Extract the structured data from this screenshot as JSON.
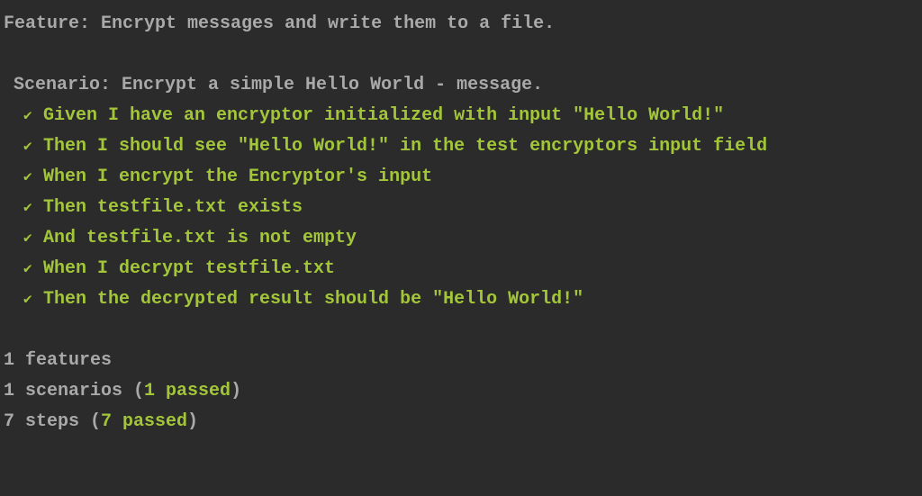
{
  "feature": {
    "label": "Feature: Encrypt messages and write them to a file."
  },
  "scenario": {
    "label": " Scenario: Encrypt a simple Hello World - message.",
    "steps": [
      {
        "check": "✔",
        "text": "Given I have an encryptor initialized with input \"Hello World!\""
      },
      {
        "check": "✔",
        "text": "Then I should see \"Hello World!\" in the test encryptors input field"
      },
      {
        "check": "✔",
        "text": "When I encrypt the Encryptor's input"
      },
      {
        "check": "✔",
        "text": "Then testfile.txt exists"
      },
      {
        "check": "✔",
        "text": "And testfile.txt is not empty"
      },
      {
        "check": "✔",
        "text": "When I decrypt testfile.txt"
      },
      {
        "check": "✔",
        "text": "Then the decrypted result should be \"Hello World!\""
      }
    ]
  },
  "summary": {
    "features_count": "1 features",
    "scenarios_count": "1 scenarios ",
    "scenarios_passed": "1 passed",
    "steps_count": "7 steps ",
    "steps_passed": "7 passed",
    "open_paren": "(",
    "close_paren": ")"
  }
}
